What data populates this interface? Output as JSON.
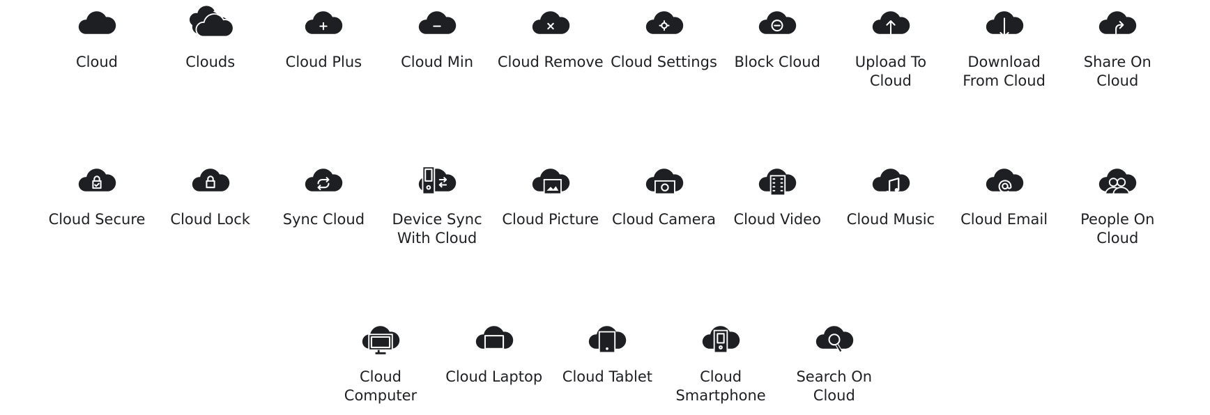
{
  "colors": {
    "icon": "#1d1f22",
    "background": "#ffffff"
  },
  "rows": [
    [
      {
        "label": "Cloud",
        "icon": "cloud-icon"
      },
      {
        "label": "Clouds",
        "icon": "clouds-icon"
      },
      {
        "label": "Cloud Plus",
        "icon": "cloud-plus-icon"
      },
      {
        "label": "Cloud Min",
        "icon": "cloud-minus-icon"
      },
      {
        "label": "Cloud Remove",
        "icon": "cloud-remove-icon"
      },
      {
        "label": "Cloud Settings",
        "icon": "cloud-settings-icon"
      },
      {
        "label": "Block Cloud",
        "icon": "block-cloud-icon"
      },
      {
        "label": "Upload To Cloud",
        "icon": "upload-cloud-icon"
      },
      {
        "label": "Download From Cloud",
        "icon": "download-cloud-icon"
      },
      {
        "label": "Share On Cloud",
        "icon": "share-cloud-icon"
      }
    ],
    [
      {
        "label": "Cloud Secure",
        "icon": "cloud-secure-icon"
      },
      {
        "label": "Cloud Lock",
        "icon": "cloud-lock-icon"
      },
      {
        "label": "Sync Cloud",
        "icon": "sync-cloud-icon"
      },
      {
        "label": "Device Sync With Cloud",
        "icon": "device-sync-cloud-icon"
      },
      {
        "label": "Cloud Picture",
        "icon": "cloud-picture-icon"
      },
      {
        "label": "Cloud Camera",
        "icon": "cloud-camera-icon"
      },
      {
        "label": "Cloud Video",
        "icon": "cloud-video-icon"
      },
      {
        "label": "Cloud Music",
        "icon": "cloud-music-icon"
      },
      {
        "label": "Cloud Email",
        "icon": "cloud-email-icon"
      },
      {
        "label": "People On Cloud",
        "icon": "people-cloud-icon"
      }
    ],
    [
      {
        "label": "Cloud Computer",
        "icon": "cloud-computer-icon"
      },
      {
        "label": "Cloud Laptop",
        "icon": "cloud-laptop-icon"
      },
      {
        "label": "Cloud Tablet",
        "icon": "cloud-tablet-icon"
      },
      {
        "label": "Cloud Smartphone",
        "icon": "cloud-smartphone-icon"
      },
      {
        "label": "Search On Cloud",
        "icon": "search-cloud-icon"
      }
    ]
  ]
}
